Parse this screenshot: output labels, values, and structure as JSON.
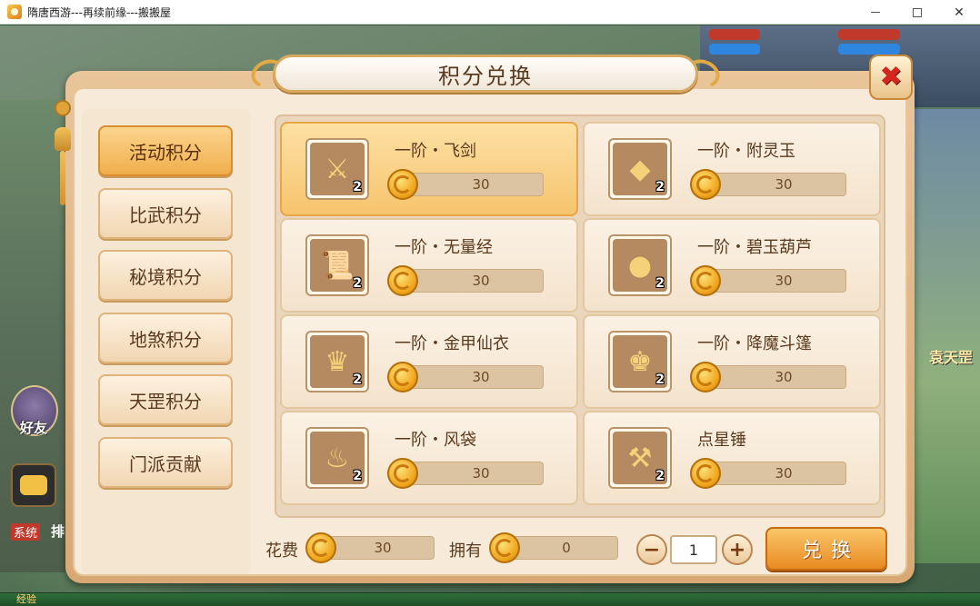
{
  "window": {
    "title": "隋唐西游---再续前缘---搬搬屋",
    "minimize_icon": "minimize-icon",
    "maximize_icon": "maximize-icon",
    "close_symbol": "✕"
  },
  "hud": {
    "friend_label": "好友",
    "system_tag": "系统",
    "system_text": "排",
    "right_name": "袁天罡",
    "exp_label": "经验"
  },
  "dialog": {
    "title": "积分兑换",
    "close_symbol": "✖"
  },
  "tabs": [
    {
      "label": "活动积分",
      "active": true
    },
    {
      "label": "比武积分",
      "active": false
    },
    {
      "label": "秘境积分",
      "active": false
    },
    {
      "label": "地煞积分",
      "active": false
    },
    {
      "label": "天罡积分",
      "active": false
    },
    {
      "label": "门派贡献",
      "active": false
    }
  ],
  "items": [
    {
      "name": "一阶・飞剑",
      "price": "30",
      "count": "2",
      "icon": "sword-icon",
      "glyph": "⚔",
      "selected": true
    },
    {
      "name": "一阶・附灵玉",
      "price": "30",
      "count": "2",
      "icon": "jade-icon",
      "glyph": "◆",
      "selected": false
    },
    {
      "name": "一阶・无量经",
      "price": "30",
      "count": "2",
      "icon": "scroll-icon",
      "glyph": "📜",
      "selected": false
    },
    {
      "name": "一阶・碧玉葫芦",
      "price": "30",
      "count": "2",
      "icon": "gourd-icon",
      "glyph": "●",
      "selected": false
    },
    {
      "name": "一阶・金甲仙衣",
      "price": "30",
      "count": "2",
      "icon": "armor-icon",
      "glyph": "♛",
      "selected": false
    },
    {
      "name": "一阶・降魔斗篷",
      "price": "30",
      "count": "2",
      "icon": "cloak-icon",
      "glyph": "♚",
      "selected": false
    },
    {
      "name": "一阶・风袋",
      "price": "30",
      "count": "2",
      "icon": "wind-bag-icon",
      "glyph": "♨",
      "selected": false
    },
    {
      "name": "点星锤",
      "price": "30",
      "count": "2",
      "icon": "hammer-icon",
      "glyph": "⚒",
      "selected": false
    }
  ],
  "footer": {
    "cost_label": "花费",
    "cost_value": "30",
    "own_label": "拥有",
    "own_value": "0",
    "minus_symbol": "−",
    "plus_symbol": "+",
    "quantity": "1",
    "exchange_label": "兑换"
  },
  "colors": {
    "accent": "#f0ae4c",
    "currency": "#f0a51c",
    "close": "#d2261f"
  }
}
